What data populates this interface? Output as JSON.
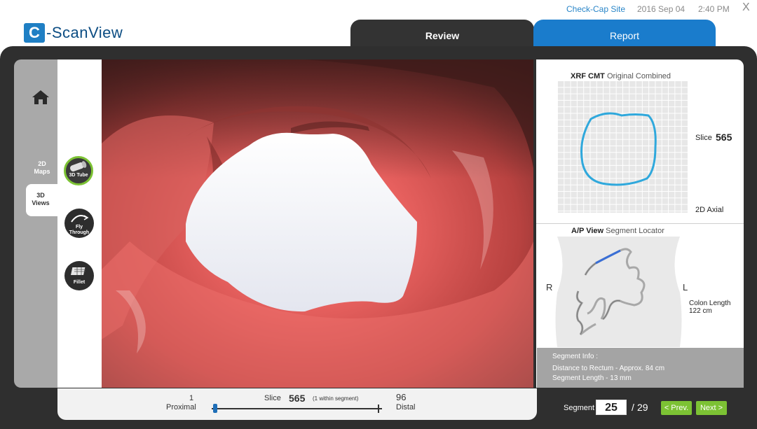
{
  "app": {
    "logo_letter": "C",
    "logo_text": "-ScanView",
    "site": "Check-Cap Site",
    "date": "2016 Sep 04",
    "time": "2:40 PM",
    "close_glyph": "X"
  },
  "tabs": [
    {
      "label": "Review",
      "active": true
    },
    {
      "label": "Report",
      "active": false
    }
  ],
  "rail": {
    "home_icon": "home-icon",
    "maps_label_1": "2D",
    "maps_label_2": "Maps",
    "views_label_1": "3D",
    "views_label_2": "Views"
  },
  "tools": {
    "tube": "3D Tube",
    "fly_1": "Fly",
    "fly_2": "Through",
    "fillet": "Fillet"
  },
  "slice_bar": {
    "start_value": "1",
    "start_label": "Proximal",
    "slice_label": "Slice",
    "slice_value": "565",
    "slice_note": "(1 within segment)",
    "end_value": "96",
    "end_label": "Distal",
    "position_fraction": 0.01
  },
  "xrf": {
    "title_bold": "XRF CMT",
    "title_rest": " Original Combined",
    "slice_label": "Slice",
    "slice_value": "565",
    "view_label": "2D Axial",
    "contour_color": "#2fa8dc"
  },
  "locator": {
    "title_bold": "A/P View",
    "title_rest": " Segment Locator",
    "left_side": "R",
    "right_side": "L",
    "length_label": "Colon Length",
    "length_value": "122 cm",
    "highlight_color": "#3a6fd6"
  },
  "segment_info": {
    "title": "Segment Info :",
    "distance": "Distance to Rectum - Approx. 84 cm",
    "length": "Segment Length - 13 mm"
  },
  "segment_nav": {
    "label": "Segment",
    "current": "25",
    "separator": "/",
    "total": "29",
    "prev_label": "< Prev.",
    "next_label": "Next >",
    "button_color": "#7cc234"
  }
}
